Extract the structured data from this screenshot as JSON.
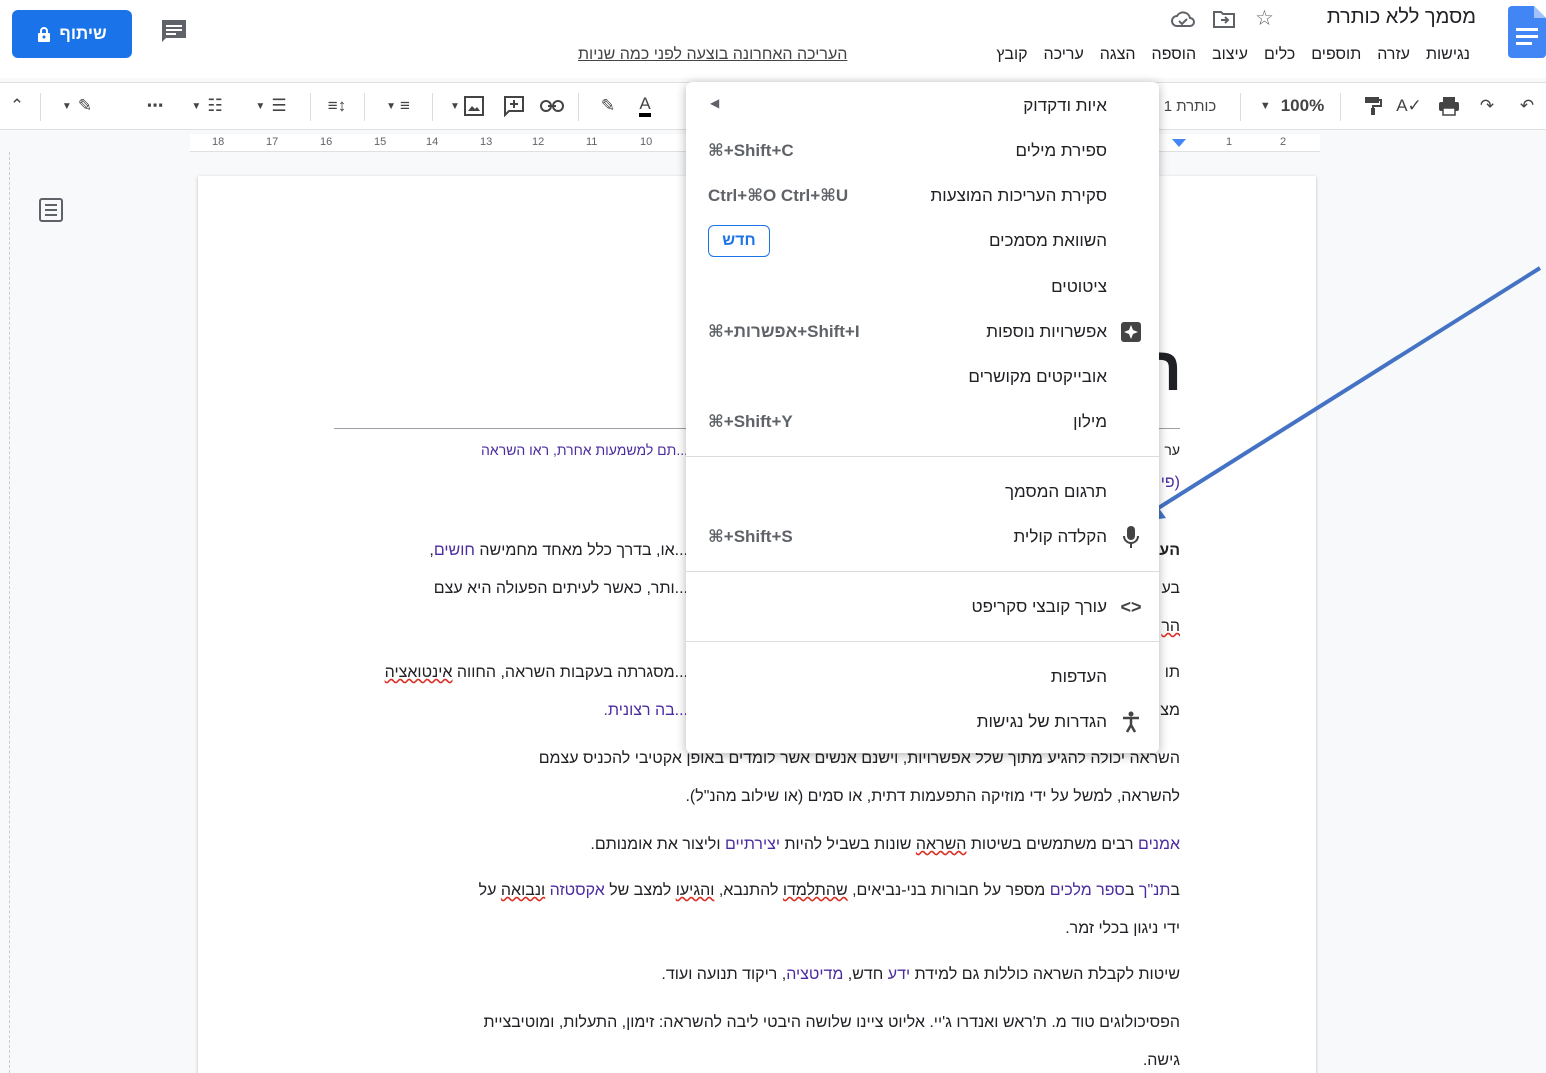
{
  "header": {
    "doc_title": "מסמך ללא כותרת",
    "menu": [
      "קובץ",
      "עריכה",
      "הצגה",
      "הוספה",
      "עיצוב",
      "כלים",
      "תוספים",
      "עזרה",
      "נגישות"
    ],
    "last_edit": "העריכה האחרונה בוצעה לפני כמה שניות",
    "share_label": "שיתוף"
  },
  "toolbar": {
    "zoom": "100%",
    "style": "כותרת 1",
    "text_color_letter": "A"
  },
  "ruler": {
    "ticks_left": [
      "18",
      "17",
      "16",
      "15",
      "14",
      "13",
      "12",
      "11",
      "10"
    ],
    "ticks_right": [
      "1",
      "2"
    ]
  },
  "tools_menu": {
    "items": [
      {
        "label": "איות ודקדוק",
        "shortcut": "",
        "has_submenu": true
      },
      {
        "label": "ספירת מילים",
        "shortcut": "⌘+Shift+C"
      },
      {
        "label": "סקירת העריכות המוצעות",
        "shortcut": "Ctrl+⌘O Ctrl+⌘U"
      },
      {
        "label": "השוואת מסמכים",
        "shortcut": "",
        "badge": "חדש"
      },
      {
        "label": "ציטוטים",
        "shortcut": ""
      },
      {
        "label": "אפשרויות נוספות",
        "shortcut": "⌘+אפשרות+Shift+I",
        "icon": "sparkle-icon"
      },
      {
        "label": "אובייקטים מקושרים",
        "shortcut": ""
      },
      {
        "label": "מילון",
        "shortcut": "⌘+Shift+Y"
      },
      {
        "label": "תרגום המסמך",
        "shortcut": ""
      },
      {
        "label": "הקלדה קולית",
        "shortcut": "⌘+Shift+S",
        "icon": "microphone-icon"
      },
      {
        "label": "עורך קובצי סקריפט",
        "shortcut": "",
        "icon": "code-icon"
      },
      {
        "label": "העדפות",
        "shortcut": ""
      },
      {
        "label": "הגדרות של נגישות",
        "shortcut": "",
        "icon": "accessibility-icon"
      }
    ]
  },
  "document": {
    "big_heading_fragment": "ה",
    "hatnote_left": "...תם למשמעות אחרת, ראו השראה",
    "hatnote_right_fragment": "ער",
    "paren_fragment": "(פי",
    "p1_frag": "השר",
    "p1_right": "הע",
    "p1_left": "...או, בדרך כלל מאחד מחמישה",
    "p1_link": "חושים",
    "p1_end": ",",
    "p2_right": "בע",
    "p2_left": "...ותר, כאשר לעיתים הפעולה היא עצם",
    "p3_right": "הר",
    "p4_right": "תו",
    "p4_left": "...מסגרתה בעקבות השראה, החווה",
    "p4_err": "אינטואציה",
    "p5_right": "מצ",
    "p5_link": "...בה רצונית.",
    "p6": "השראה יכולה להגיע מתוך שלל אפשרויות, וישנם אנשים אשר לומדים באופן אקטיבי להכניס עצמם",
    "p7": "להשראה, למשל על ידי מוזיקה התפעמות דתית, או סמים (או שילוב מהנ\"ל).",
    "p8_link1": "אמנים",
    "p8_a": " רבים משתמשים בשיטות ",
    "p8_err": "השראה",
    "p8_b": " שונות בשביל להיות ",
    "p8_link2": "יצירתיים",
    "p8_c": " וליצור את אומנותם.",
    "p9_a": "ב",
    "p9_link1": "תנ\"ך",
    "p9_b": " ב",
    "p9_link2": "ספר מלכים",
    "p9_c": " מספר על חבורות בני-נביאים, ",
    "p9_err1": "שהתלמדו",
    "p9_d": " להתנבא, ",
    "p9_err2": "והגיעו",
    "p9_e": " למצב של ",
    "p9_link3": "אקסטזה",
    "p9_f": " ",
    "p9_err3": "ונבואה",
    "p9_g": " על",
    "p10": "ידי ניגון בכלי זמר.",
    "p11_a": "שיטות לקבלת השראה כוללות גם למידת ",
    "p11_link1": "ידע",
    "p11_b": " חדש, ",
    "p11_link2": "מדיטציה",
    "p11_c": ", ריקוד תנועה ועוד.",
    "p12": "הפסיכולוגים טוד מ. ת'ראש ואנדרו ג'יי. אליוט ציינו שלושה היבטי ליבה להשראה: זימון, התעלות, ומוטיבציית",
    "p13": "גישה."
  },
  "colors": {
    "accent": "#1a73e8",
    "link": "#4b2ca0",
    "arrow": "#4472c4"
  }
}
